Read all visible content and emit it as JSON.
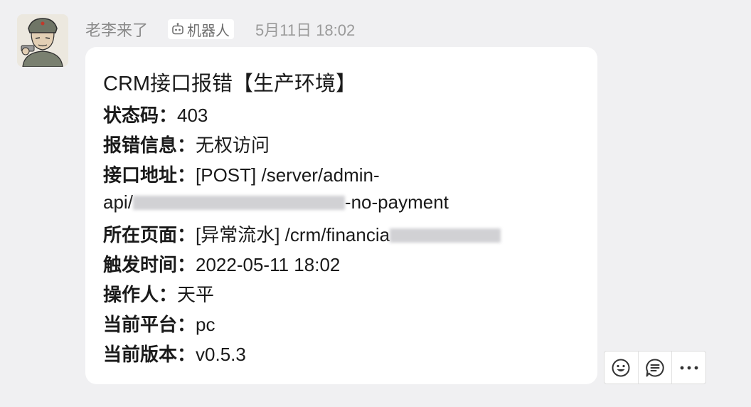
{
  "message": {
    "sender": "老李来了",
    "bot_tag": "机器人",
    "timestamp": "5月11日 18:02",
    "title": "CRM接口报错【生产环境】",
    "fields": [
      {
        "label": "状态码：",
        "value": "403"
      },
      {
        "label": "报错信息：",
        "value": "无权访问"
      },
      {
        "label": "接口地址：",
        "value": "[POST] /server/admin-"
      },
      {
        "label": "所在页面：",
        "value": "[异常流水] /crm/financia"
      },
      {
        "label": "触发时间：",
        "value": "2022-05-11 18:02"
      },
      {
        "label": "操作人：",
        "value": "天平"
      },
      {
        "label": "当前平台：",
        "value": "pc"
      },
      {
        "label": "当前版本：",
        "value": "v0.5.3"
      }
    ],
    "api_continuation_prefix": "api/",
    "api_continuation_suffix": "-no-payment"
  },
  "actions": {
    "icons": [
      "emoji-reaction-icon",
      "reply-icon",
      "more-icon"
    ]
  },
  "colors": {
    "background": "#f0f0f2",
    "bubble": "#ffffff",
    "meta_text": "#8a8a8a",
    "body_text": "#1a1a1a"
  }
}
